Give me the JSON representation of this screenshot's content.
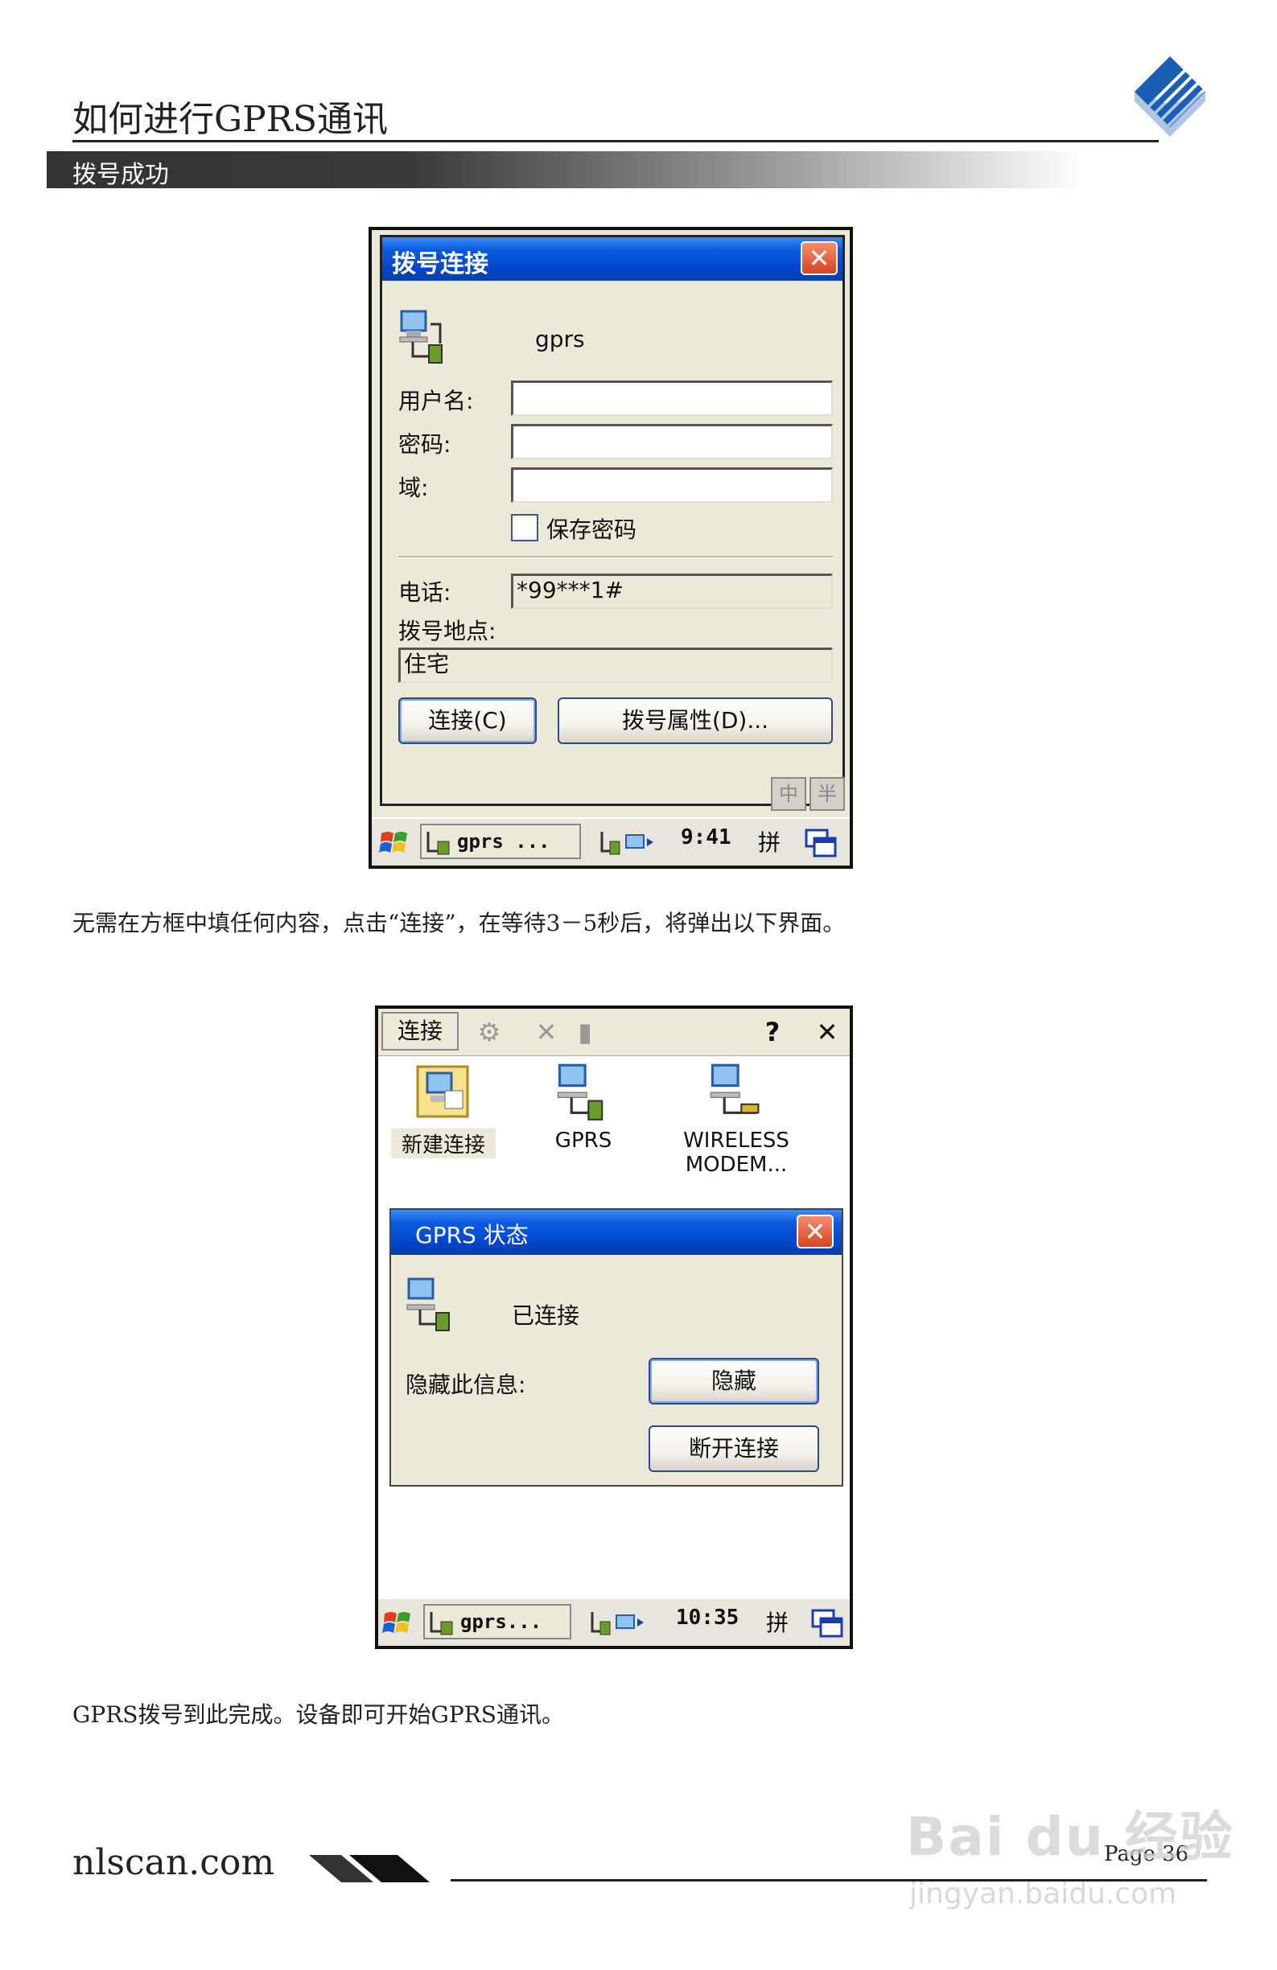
{
  "header": {
    "title": "如何进行GPRS通讯",
    "section": "拨号成功"
  },
  "dialog1": {
    "title": "拨号连接",
    "connection_name": "gprs",
    "username_label": "用户名:",
    "username_value": "",
    "password_label": "密码:",
    "password_value": "",
    "domain_label": "域:",
    "domain_value": "",
    "save_password_label": "保存密码",
    "save_password_checked": false,
    "phone_label": "电话:",
    "phone_value": "*99***1#",
    "dial_from_label": "拨号地点:",
    "dial_from_value": "住宅",
    "connect_button": "连接(C)",
    "dial_props_button": "拨号属性(D)...",
    "ime_zh": "中",
    "ime_half": "半",
    "taskbar": {
      "app": "gprs ...",
      "time": "9:41",
      "ime": "拼"
    }
  },
  "paragraph1": "无需在方框中填任何内容，点击“连接”，在等待3－5秒后，将弹出以下界面。",
  "dialog2": {
    "menu_label": "连接",
    "connections": [
      {
        "label": "新建连接",
        "icon": "new-connection-icon"
      },
      {
        "label": "GPRS",
        "icon": "network-computer-icon"
      },
      {
        "label": "WIRELESS MODEM...",
        "icon": "modem-icon"
      }
    ],
    "status_title": "GPRS 状态",
    "status_text": "已连接",
    "hide_label": "隐藏此信息:",
    "hide_button": "隐藏",
    "disconnect_button": "断开连接",
    "taskbar": {
      "app": "gprs...",
      "time": "10:35",
      "ime": "拼"
    }
  },
  "paragraph2": "GPRS拨号到此完成。设备即可开始GPRS通讯。",
  "footer": {
    "site": "nlscan.com",
    "page": "Page 36"
  },
  "watermark": {
    "brand": "Bai du 经验",
    "url": "jingyan.baidu.com"
  },
  "colors": {
    "titlebar_blue": "#0046c8",
    "close_red": "#d8441f",
    "dialog_bg": "#ece9d8"
  }
}
